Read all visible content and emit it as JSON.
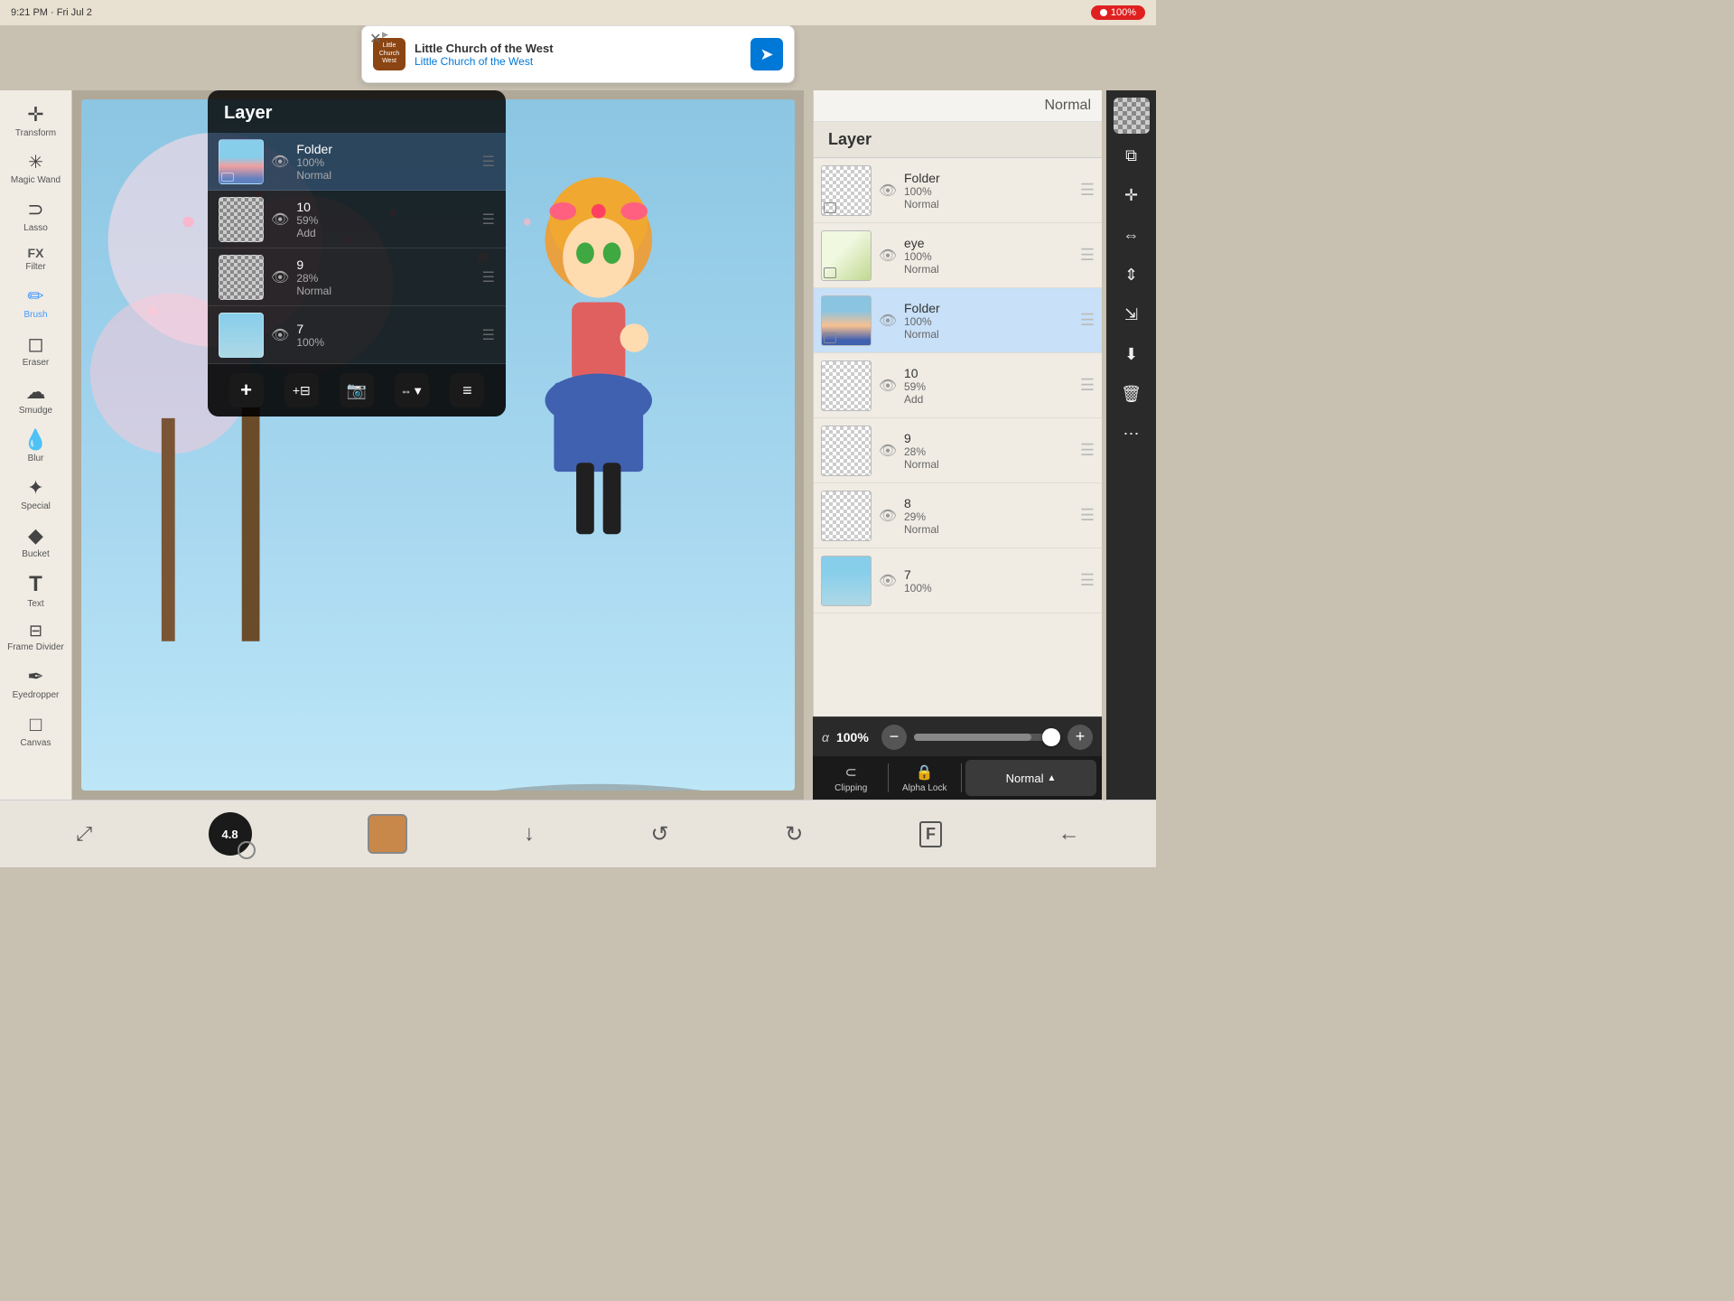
{
  "statusBar": {
    "time": "9:21 PM · Fri Jul 2",
    "recordLabel": "●",
    "batteryLabel": "100%"
  },
  "ad": {
    "title": "Little Church of the West",
    "subtitle": "Little Church of the West",
    "closeLabel": "✕",
    "sponsorLabel": "▶"
  },
  "leftTools": [
    {
      "id": "transform",
      "icon": "✛",
      "label": "Transform"
    },
    {
      "id": "magic-wand",
      "icon": "✳",
      "label": "Magic Wand"
    },
    {
      "id": "lasso",
      "icon": "◯",
      "label": "Lasso"
    },
    {
      "id": "filter",
      "icon": "FX",
      "label": "Filter"
    },
    {
      "id": "brush",
      "icon": "✏",
      "label": "Brush",
      "active": true
    },
    {
      "id": "eraser",
      "icon": "⬡",
      "label": "Eraser"
    },
    {
      "id": "smudge",
      "icon": "⬟",
      "label": "Smudge"
    },
    {
      "id": "blur",
      "icon": "💧",
      "label": "Blur"
    },
    {
      "id": "special",
      "icon": "✦",
      "label": "Special"
    },
    {
      "id": "bucket",
      "icon": "◆",
      "label": "Bucket"
    },
    {
      "id": "text",
      "icon": "T",
      "label": "Text"
    },
    {
      "id": "frame-divider",
      "icon": "⊟",
      "label": "Frame Divider"
    },
    {
      "id": "eyedropper",
      "icon": "✒",
      "label": "Eyedropper"
    },
    {
      "id": "canvas",
      "icon": "□",
      "label": "Canvas"
    }
  ],
  "layerPanel": {
    "title": "Layer",
    "topNormal": "Normal",
    "layers": [
      {
        "id": "folder1",
        "name": "Folder",
        "opacity": "100%",
        "blend": "Normal",
        "isFolder": true,
        "selected": false,
        "eyeVisible": true
      },
      {
        "id": "eye",
        "name": "eye",
        "opacity": "100%",
        "blend": "Normal",
        "isFolder": false,
        "selected": false,
        "eyeVisible": true
      },
      {
        "id": "folder2",
        "name": "Folder",
        "opacity": "100%",
        "blend": "Normal",
        "isFolder": true,
        "selected": true,
        "eyeVisible": true
      },
      {
        "id": "layer10",
        "name": "10",
        "opacity": "59%",
        "blend": "Add",
        "isFolder": false,
        "selected": false,
        "eyeVisible": true
      },
      {
        "id": "layer9",
        "name": "9",
        "opacity": "28%",
        "blend": "Normal",
        "isFolder": false,
        "selected": false,
        "eyeVisible": true
      },
      {
        "id": "layer8",
        "name": "8",
        "opacity": "29%",
        "blend": "Normal",
        "isFolder": false,
        "selected": false,
        "eyeVisible": true
      },
      {
        "id": "layer7",
        "name": "7",
        "opacity": "100%",
        "blend": "",
        "isFolder": false,
        "selected": false,
        "eyeVisible": true,
        "hasContent": true
      }
    ],
    "blendMode": "Normal",
    "alphaLabel": "α",
    "alphaValue": "100%"
  },
  "rightTools": [
    {
      "id": "checkerboard",
      "icon": ""
    },
    {
      "id": "copy-paste",
      "icon": "⧉"
    },
    {
      "id": "move",
      "icon": "✛"
    },
    {
      "id": "flip-horizontal",
      "icon": "⇔"
    },
    {
      "id": "flip-vertical",
      "icon": "⇕"
    },
    {
      "id": "shrink",
      "icon": "⇲"
    },
    {
      "id": "download",
      "icon": "⬇"
    },
    {
      "id": "trash",
      "icon": "🗑"
    },
    {
      "id": "more",
      "icon": "⋯"
    }
  ],
  "layerOptions": [
    {
      "id": "clipping",
      "icon": "⊂",
      "label": "Clipping"
    },
    {
      "id": "alpha-lock",
      "icon": "🔒",
      "label": "Alpha Lock"
    }
  ],
  "alpha": {
    "label": "α",
    "value": "100%",
    "fill": "80"
  },
  "bottomBar": {
    "brushSize": "4.8",
    "colorSwatchColor": "#c8884a",
    "buttons": [
      {
        "id": "transform-btn",
        "icon": "⤢"
      },
      {
        "id": "undo-btn",
        "icon": "↺"
      },
      {
        "id": "redo-btn",
        "icon": "↻"
      },
      {
        "id": "gallery-btn",
        "icon": "F"
      },
      {
        "id": "back-btn",
        "icon": "←"
      }
    ]
  },
  "popup": {
    "title": "Layer",
    "layers": [
      {
        "id": "folder2",
        "name": "Folder",
        "opacity": "100%",
        "blend": "Normal",
        "isFolder": true,
        "selected": true,
        "thumbType": "char"
      },
      {
        "id": "layer10",
        "name": "10",
        "opacity": "59%",
        "blend": "Add",
        "isFolder": false,
        "selected": false,
        "thumbType": "plain"
      },
      {
        "id": "layer9",
        "name": "9",
        "opacity": "28%",
        "blend": "Normal",
        "isFolder": false,
        "selected": false,
        "thumbType": "plain"
      },
      {
        "id": "layer7",
        "name": "7",
        "opacity": "100%",
        "blend": "",
        "isFolder": false,
        "selected": false,
        "thumbType": "sky"
      }
    ],
    "actions": [
      {
        "id": "add",
        "icon": "+",
        "label": ""
      },
      {
        "id": "add-group",
        "icon": "+⊟",
        "label": ""
      },
      {
        "id": "camera",
        "icon": "📷",
        "label": ""
      },
      {
        "id": "flip",
        "icon": "⇔▼",
        "label": ""
      },
      {
        "id": "more2",
        "icon": "≡",
        "label": ""
      }
    ]
  }
}
